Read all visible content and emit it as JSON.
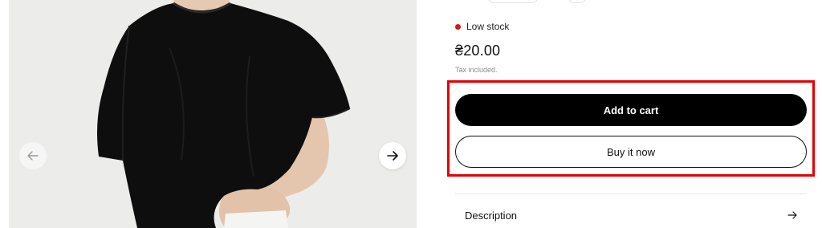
{
  "gallery": {
    "image_icon": "product-photo-black-tshirt",
    "prev_icon": "arrow-left-icon",
    "next_icon": "arrow-right-icon"
  },
  "product": {
    "stock_label": "Low stock",
    "stock_color": "#d11a1a",
    "price": "₴20.00",
    "tax_note": "Tax included."
  },
  "actions": {
    "add_to_cart_label": "Add to cart",
    "buy_now_label": "Buy it now",
    "highlight_color": "#e60000"
  },
  "accordion": {
    "description_label": "Description",
    "arrow_icon": "arrow-right-icon"
  }
}
